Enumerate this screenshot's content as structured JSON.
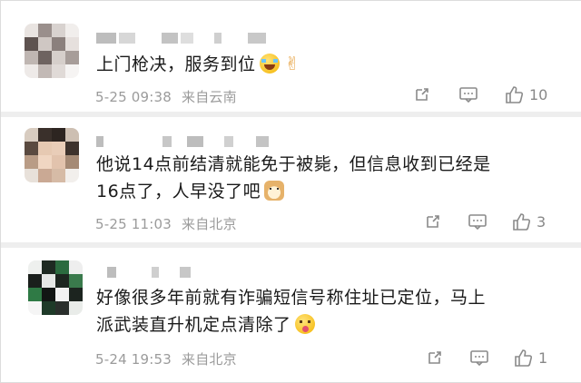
{
  "comments": [
    {
      "text_lines": [
        "上门枪决，服务到位"
      ],
      "emojis": [
        "laughing-with-tears-icon",
        "victory-hand-icon"
      ],
      "date": "5-25 09:38",
      "location": "来自云南",
      "likes": "10"
    },
    {
      "text_lines": [
        "他说14点前结清就能免于被毙，但信息收到已经是",
        "16点了，人早没了吧"
      ],
      "emojis": [
        "doge-icon"
      ],
      "date": "5-25 11:03",
      "location": "来自北京",
      "likes": "3"
    },
    {
      "text_lines": [
        "好像很多年前就有诈骗短信号称住址已定位，马上",
        "派武装直升机定点清除了"
      ],
      "emojis": [
        "tongue-out-icon"
      ],
      "date": "5-24 19:53",
      "location": "来自北京",
      "likes": "1"
    }
  ]
}
